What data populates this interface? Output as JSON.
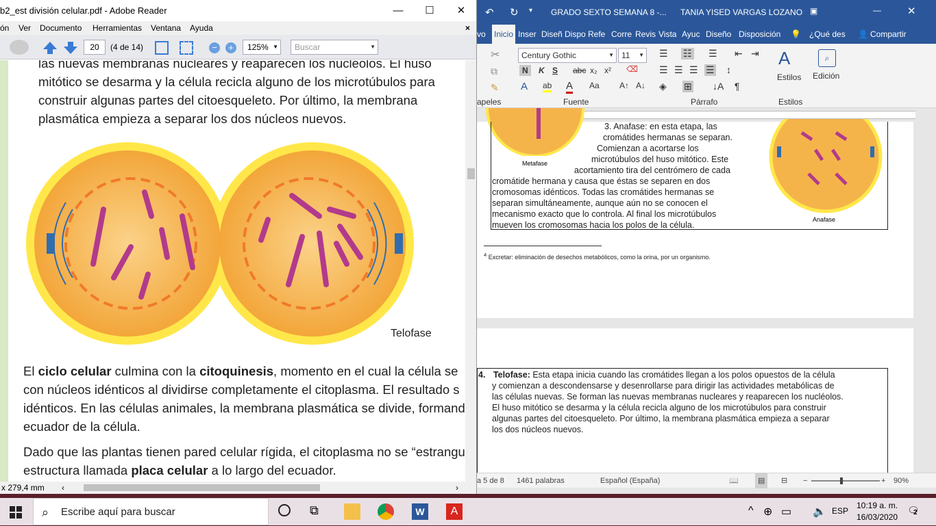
{
  "reader": {
    "title": "b2_est división celular.pdf - Adobe Reader",
    "menu": [
      "ón",
      "Ver",
      "Documento",
      "Herramientas",
      "Ventana",
      "Ayuda"
    ],
    "page_current": "20",
    "page_total": "(4 de 14)",
    "zoom": "125%",
    "search_placeholder": "Buscar",
    "para1": [
      "las nuevas membranas nucleares y reaparecen los nucléolos. El huso",
      "mitótico se desarma y la célula recicla alguno de los microtúbulos para",
      "construir algunas partes del citoesqueleto. Por último, la membrana",
      "plasmática empieza a separar los dos núcleos nuevos."
    ],
    "figure_label": "Telofase",
    "para2": {
      "l1_a": "El ",
      "l1_b": "ciclo celular",
      "l1_c": " culmina con la ",
      "l1_d": "citoquinesis",
      "l1_e": ", momento en el cual la célula se",
      "l2": "con núcleos idénticos al dividirse completamente el citoplasma. El resultado s",
      "l3": "idénticos. En las células animales, la membrana plasmática se divide, formand",
      "l4": "ecuador de la célula."
    },
    "para3": {
      "l1": "Dado que las plantas tienen pared celular rígida, el citoplasma no se “estrangu",
      "l2_a": "estructura llamada ",
      "l2_b": "placa celular",
      "l2_c": " a lo largo del ecuador."
    },
    "page_size": "x 279,4 mm"
  },
  "word": {
    "title": "GRADO SEXTO SEMANA 8  -...",
    "user": "TANIA YISED VARGAS LOZANO",
    "tabs": [
      "vo",
      "Inicio",
      "Inser",
      "Diseñ",
      "Dispo",
      "Refe",
      "Corre",
      "Revis",
      "Vista",
      "Ayuc",
      "Diseño",
      "Disposición",
      "¿Qué des",
      "Compartir"
    ],
    "font_name": "Century Gothic",
    "font_size": "11",
    "groups": [
      "apeles",
      "Fuente",
      "Párrafo",
      "Estilos"
    ],
    "estilos": "Estilos",
    "edicion": "Edición",
    "metafase_label": "Metafase",
    "anafase_label": "Anafase",
    "anafase_lines": [
      "3.  Anafase: en esta etapa, las",
      "cromátides hermanas se separan.",
      "Comienzan   a   acortarse   los",
      "microtúbulos del huso mitótico. Este",
      "acortamiento tira del centrómero de cada",
      "cromátide hermana y causa que éstas se separen en dos",
      "cromosomas idénticos. Todas las cromátides hermanas se",
      "separan simultáneamente, aunque aún no se conocen el",
      "mecanismo exacto que lo controla. Al final los microtúbulos",
      "mueven los cromosomas hacia los polos de la célula."
    ],
    "footnote": "Excretar: eliminación de desechos metabólicos, como la orina, por un organismo.",
    "footnote_num": "4",
    "telofase_num": "4.",
    "telofase_head": "Telofase:",
    "telofase_lines": [
      " Esta etapa inicia cuando las cromátides llegan a los polos opuestos de la célula",
      "y comienzan a descondensarse y desenrollarse para dirigir las actividades metabólicas de",
      "las células nuevas. Se forman las nuevas membranas nucleares y reaparecen los nucléolos.",
      "El huso mitótico se desarma y la célula recicla alguno de los microtúbulos para construir",
      "algunas partes del citoesqueleto. Por último, la membrana plasmática empieza a separar",
      "los dos núcleos nuevos."
    ],
    "status_page": "a 5 de 8",
    "status_words": "1461 palabras",
    "status_lang": "Español (España)",
    "zoom": "90%"
  },
  "taskbar": {
    "search": "Escribe aquí para buscar",
    "lang": "ESP",
    "time": "10:19 a. m.",
    "date": "16/03/2020",
    "notif": "2"
  }
}
